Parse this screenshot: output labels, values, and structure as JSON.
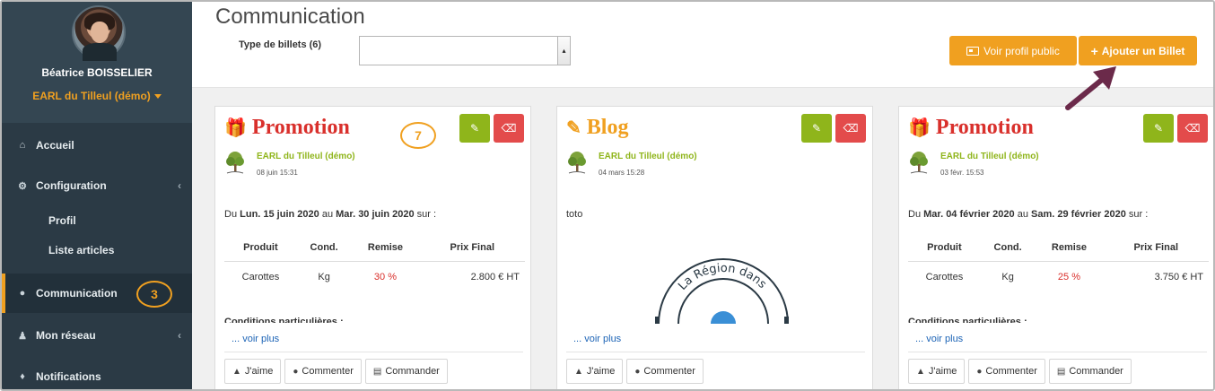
{
  "sidebar": {
    "user_name": "Béatrice BOISSELIER",
    "org_name": "EARL du Tilleul (démo)",
    "items": [
      {
        "label": "Accueil",
        "icon": "home-icon"
      },
      {
        "label": "Configuration",
        "icon": "cogs-icon"
      },
      {
        "label": "Profil"
      },
      {
        "label": "Liste articles"
      },
      {
        "label": "Communication",
        "icon": "comments-icon"
      },
      {
        "label": "Mon réseau",
        "icon": "network-icon"
      },
      {
        "label": "Notifications",
        "icon": "bell-icon"
      }
    ],
    "step_badge": "3"
  },
  "header": {
    "title": "Communication",
    "filter_label": "Type de billets (6)",
    "filter_value": "",
    "profile_button": "Voir profil public",
    "add_button": "Ajouter un Billet"
  },
  "annotations": {
    "step_7": "7"
  },
  "cards": [
    {
      "type": "Promotion",
      "author": "EARL du Tilleul (démo)",
      "date": "08 juin 15:31",
      "period_prefix": "Du ",
      "period_start": "Lun. 15 juin 2020",
      "period_mid": " au ",
      "period_end": "Mar. 30 juin 2020",
      "period_suffix": " sur :",
      "table_headers": [
        "Produit",
        "Cond.",
        "Remise",
        "Prix Final"
      ],
      "row": {
        "product": "Carottes",
        "cond": "Kg",
        "discount": "30 %",
        "final": "2.800 € HT"
      },
      "conditions": "Conditions particulières :",
      "more": "... voir plus"
    },
    {
      "type": "Blog",
      "author": "EARL du Tilleul (démo)",
      "date": "04 mars 15:28",
      "body": "toto",
      "logo_text": "La Région dans",
      "more": "... voir plus"
    },
    {
      "type": "Promotion",
      "author": "EARL du Tilleul (démo)",
      "date": "03 févr. 15:53",
      "period_prefix": "Du ",
      "period_start": "Mar. 04 février 2020",
      "period_mid": " au ",
      "period_end": "Sam. 29 février 2020",
      "period_suffix": " sur :",
      "table_headers": [
        "Produit",
        "Cond.",
        "Remise",
        "Prix Final"
      ],
      "row": {
        "product": "Carottes",
        "cond": "Kg",
        "discount": "25 %",
        "final": "3.750 € HT"
      },
      "conditions": "Conditions particulières :",
      "more": "... voir plus"
    }
  ],
  "actions": {
    "like": "J'aime",
    "comment": "Commenter",
    "order": "Commander"
  },
  "colors": {
    "accent": "#f0a020",
    "sidebar": "#2b3a45",
    "promo": "#d9302c",
    "green": "#8fb51b",
    "danger": "#e34b4b",
    "annotation_arrow": "#6b2a4a"
  }
}
